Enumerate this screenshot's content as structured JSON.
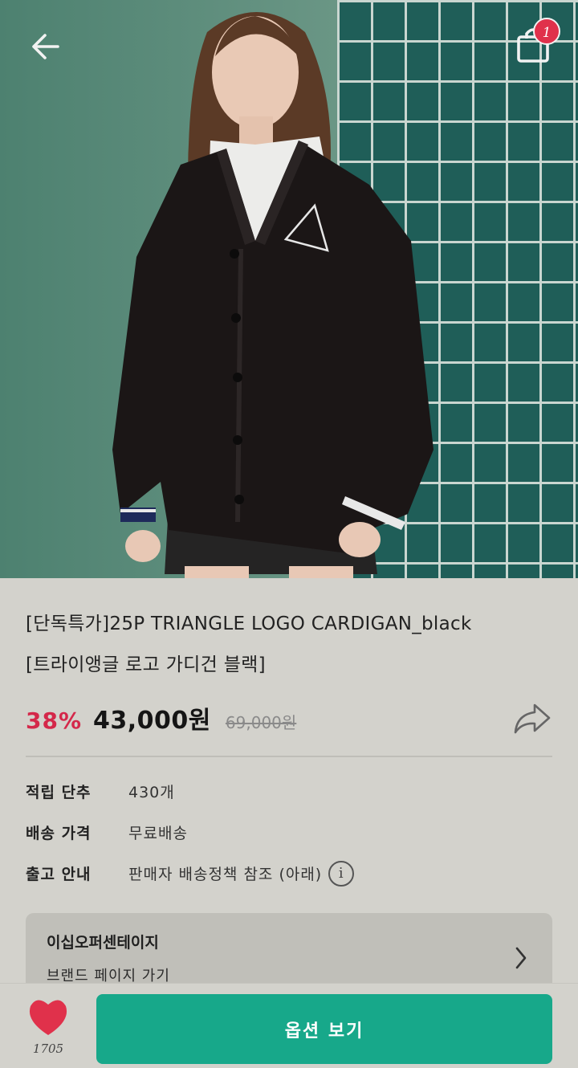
{
  "header": {
    "back_icon": "arrow-left-icon",
    "cart_icon": "shopping-bag-icon",
    "cart_count": "1"
  },
  "hero": {
    "image_subject": "model wearing black v-neck cardigan with triangle logo against green tiled wall",
    "colors": {
      "wall": "#5b8a78",
      "tile": "#1f5e58",
      "cardigan": "#1b1616"
    }
  },
  "product": {
    "title_line1": "[단독특가]25P TRIANGLE LOGO CARDIGAN_black",
    "title_line2": "[트라이앵글 로고 가디건 블랙]",
    "discount": "38%",
    "price": "43,000원",
    "original_price": "69,000원",
    "share_icon": "share-arrow-icon"
  },
  "info": [
    {
      "label": "적립 단추",
      "value": "430개"
    },
    {
      "label": "배송 가격",
      "value": "무료배송"
    },
    {
      "label": "출고 안내",
      "value": "판매자 배송정책 참조 (아래)",
      "icon": "info-icon"
    }
  ],
  "brand": {
    "name": "이십오퍼센테이지",
    "link_label": "브랜드 페이지 가기",
    "chevron_icon": "chevron-right-icon"
  },
  "bottom": {
    "like_icon": "heart-icon",
    "like_count": "1705",
    "cta_label": "옵션 보기"
  },
  "colors": {
    "accent": "#17a88a",
    "discount": "#d4284a",
    "badge": "#e0314b",
    "heart": "#e0314b",
    "background": "#d3d2cc"
  }
}
